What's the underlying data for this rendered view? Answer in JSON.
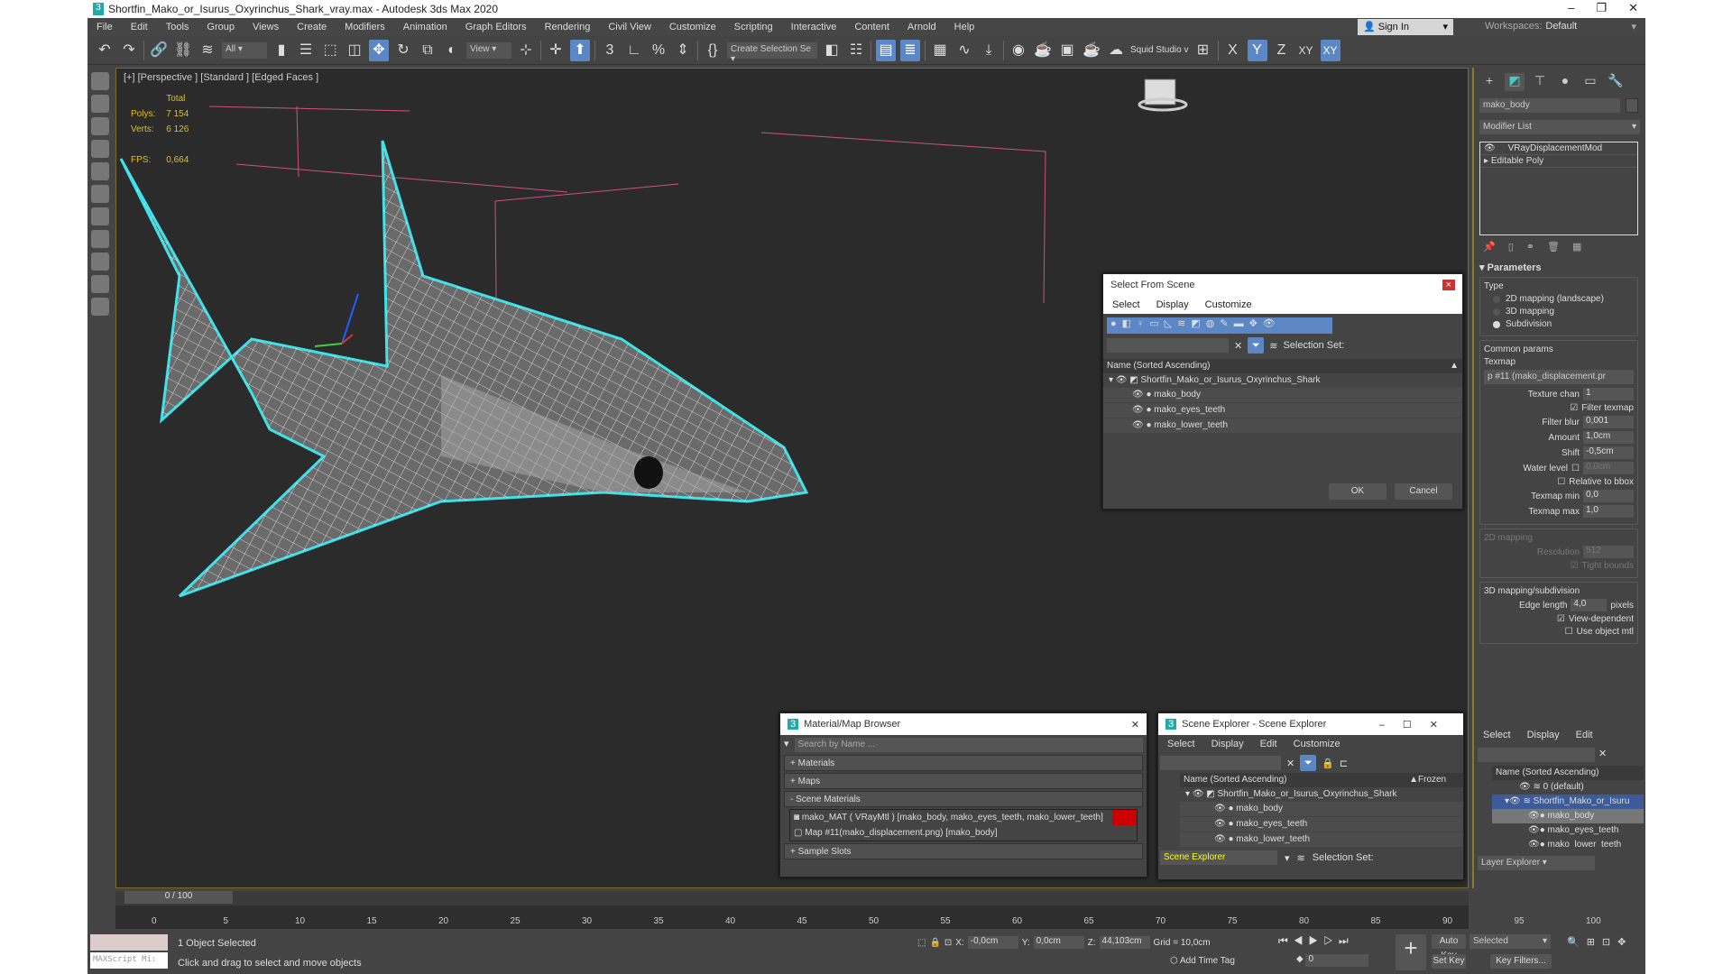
{
  "window": {
    "title": "Shortfin_Mako_or_Isurus_Oxyrinchus_Shark_vray.max - Autodesk 3ds Max 2020",
    "min": "–",
    "max": "❐",
    "close": "✕"
  },
  "menu": [
    "File",
    "Edit",
    "Tools",
    "Group",
    "Views",
    "Create",
    "Modifiers",
    "Animation",
    "Graph Editors",
    "Rendering",
    "Civil View",
    "Customize",
    "Scripting",
    "Interactive",
    "Content",
    "Arnold",
    "Help"
  ],
  "signin": "Sign In",
  "workspaces": {
    "label": "Workspaces:",
    "value": "Default"
  },
  "toolbar": {
    "filter": "All",
    "coord": "View",
    "selset": "Create Selection Se",
    "squid": "Squid Studio v",
    "axes": [
      "X",
      "Y",
      "Z",
      "XY",
      "XY"
    ]
  },
  "viewport": {
    "label": "[+] [Perspective ] [Standard ] [Edged Faces ]",
    "stats": {
      "header": "Total",
      "polys_label": "Polys:",
      "polys": "7 154",
      "verts_label": "Verts:",
      "verts": "6 126",
      "fps_label": "FPS:",
      "fps": "0,664"
    }
  },
  "command": {
    "object_name": "mako_body",
    "modifier_list": "Modifier List",
    "stack": [
      "VRayDisplacementMod",
      "Editable Poly"
    ],
    "params": {
      "title": "Parameters",
      "type_label": "Type",
      "types": [
        "2D mapping (landscape)",
        "3D mapping",
        "Subdivision"
      ],
      "selected_type": 2,
      "common": "Common params",
      "texmap": "Texmap",
      "texmap_value": "p #11 (mako_displacement.pr",
      "texture_chan_label": "Texture chan",
      "texture_chan": "1",
      "filter_texmap": "Filter texmap",
      "filter_blur_label": "Filter blur",
      "filter_blur": "0,001",
      "amount_label": "Amount",
      "amount": "1,0cm",
      "shift_label": "Shift",
      "shift": "-0,5cm",
      "water_label": "Water level",
      "water": "0,0cm",
      "relative": "Relative to bbox",
      "tmin_label": "Texmap min",
      "tmin": "0,0",
      "tmax_label": "Texmap max",
      "tmax": "1,0",
      "map2d": "2D mapping",
      "res_label": "Resolution",
      "res": "512",
      "tight": "Tight bounds",
      "map3d": "3D mapping/subdivision",
      "edge_label": "Edge length",
      "edge": "4,0",
      "pixels": "pixels",
      "viewdep": "View-dependent",
      "useobj": "Use object mtl"
    }
  },
  "layer_explorer": {
    "menu": [
      "Select",
      "Display",
      "Edit"
    ],
    "header": "Name (Sorted Ascending)",
    "items": [
      "0 (default)",
      "Shortfin_Mako_or_Isuru",
      "mako_body",
      "mako_eyes_teeth",
      "mako_lower_teeth"
    ],
    "footer": "Layer Explorer"
  },
  "select_from_scene": {
    "title": "Select From Scene",
    "menu": [
      "Select",
      "Display",
      "Customize"
    ],
    "selection_set": "Selection Set:",
    "header": "Name (Sorted Ascending)",
    "root": "Shortfin_Mako_or_Isurus_Oxyrinchus_Shark",
    "children": [
      "mako_body",
      "mako_eyes_teeth",
      "mako_lower_teeth"
    ],
    "ok": "OK",
    "cancel": "Cancel"
  },
  "material_browser": {
    "title": "Material/Map Browser",
    "search": "Search by Name ...",
    "groups": [
      "+ Materials",
      "+ Maps",
      "- Scene Materials",
      "+ Sample Slots"
    ],
    "items": [
      "mako_MAT ( VRayMtl ) [mako_body, mako_eyes_teeth, mako_lower_teeth]",
      "Map #11(mako_displacement.png) [mako_body]"
    ]
  },
  "scene_explorer": {
    "title": "Scene Explorer - Scene Explorer",
    "menu": [
      "Select",
      "Display",
      "Edit",
      "Customize"
    ],
    "header": "Name (Sorted Ascending)",
    "frozen": "Frozen",
    "root": "Shortfin_Mako_or_Isurus_Oxyrinchus_Shark",
    "children": [
      "mako_body",
      "mako_eyes_teeth",
      "mako_lower_teeth"
    ],
    "footer": "Scene Explorer",
    "selection_set": "Selection Set:"
  },
  "timeline": {
    "frame": "0 / 100",
    "ticks": [
      "0",
      "5",
      "10",
      "15",
      "20",
      "25",
      "30",
      "35",
      "40",
      "45",
      "50",
      "55",
      "60",
      "65",
      "70",
      "75",
      "80",
      "85",
      "90",
      "95",
      "100"
    ]
  },
  "status": {
    "maxscript": "MAXScript Mi:",
    "selected": "1 Object Selected",
    "prompt": "Click and drag to select and move objects",
    "x_label": "X:",
    "x": "-0,0cm",
    "y_label": "Y:",
    "y": "0,0cm",
    "z_label": "Z:",
    "z": "44,103cm",
    "grid": "Grid = 10,0cm",
    "add_time_tag": "Add Time Tag",
    "frame": "0",
    "auto_key": "Auto Key",
    "set_key": "Set Key",
    "key_mode": "Selected",
    "key_filters": "Key Filters..."
  },
  "colors": {
    "accent": "#5b87c4",
    "selection_outline": "#40e0e8",
    "stats_text": "#e0c020"
  }
}
